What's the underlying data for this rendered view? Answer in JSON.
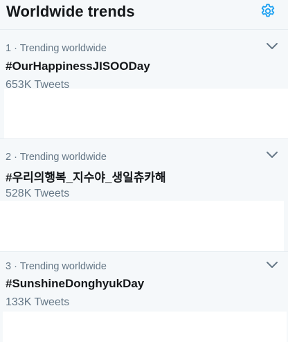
{
  "header": {
    "title": "Worldwide trends",
    "settings_icon": "gear-icon",
    "accent_color": "#1da1f2"
  },
  "trends": [
    {
      "meta": "1 · Trending worldwide",
      "name": "#OurHappinessJISOODay",
      "count": "653K Tweets",
      "menu_icon": "chevron-down-icon"
    },
    {
      "meta": "2 · Trending worldwide",
      "name": "#우리의행복_지수야_생일츄카해",
      "count": "528K Tweets",
      "menu_icon": "chevron-down-icon"
    },
    {
      "meta": "3 · Trending worldwide",
      "name": "#SunshineDonghyukDay",
      "count": "133K Tweets",
      "menu_icon": "chevron-down-icon"
    }
  ]
}
